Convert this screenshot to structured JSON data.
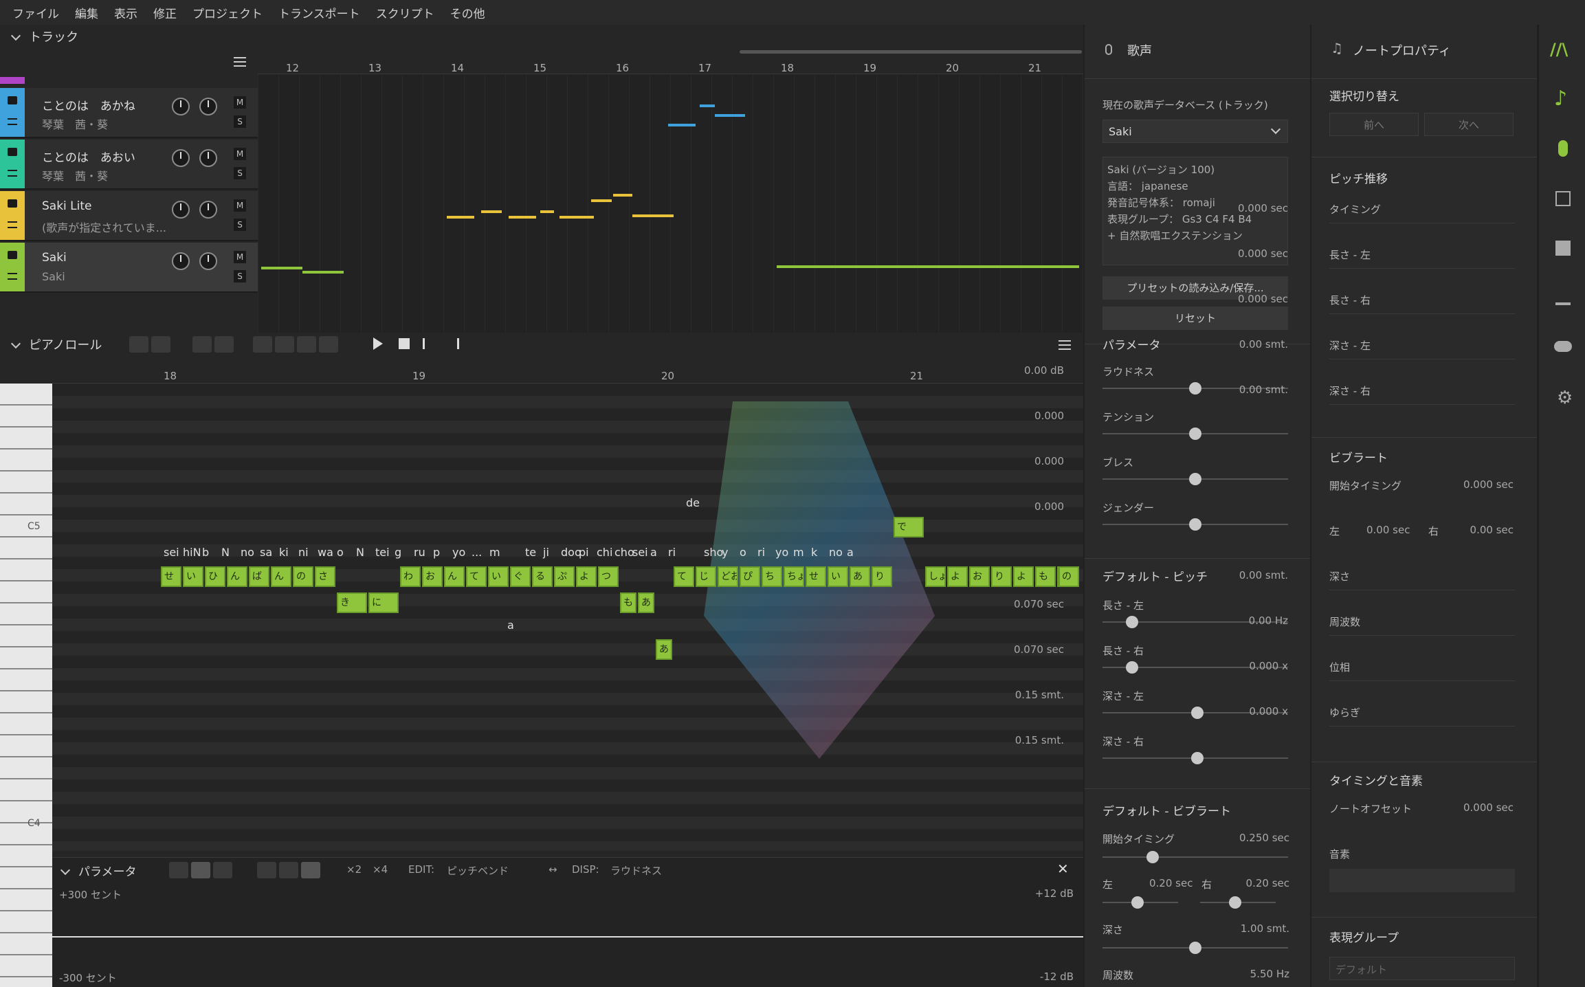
{
  "menu": [
    "ファイル",
    "編集",
    "表示",
    "修正",
    "プロジェクト",
    "トランスポート",
    "スクリプト",
    "その他"
  ],
  "track_panel": {
    "title": "トラック",
    "ruler": [
      "12",
      "13",
      "14",
      "15",
      "16",
      "17",
      "18",
      "19",
      "20",
      "21"
    ],
    "tracks": [
      {
        "name": "ことのは　あかね",
        "sub": "琴葉　茜・葵",
        "color": "#3fa2dc"
      },
      {
        "name": "ことのは　あおい",
        "sub": "琴葉　茜・葵",
        "color": "#2ec49a"
      },
      {
        "name": "Saki Lite",
        "sub": "(歌声が指定されていま...",
        "color": "#e8c23a"
      },
      {
        "name": "Saki",
        "sub": "Saki",
        "color": "#8fc53c"
      }
    ],
    "mute": "M",
    "solo": "S"
  },
  "piano_roll": {
    "title": "ピアノロール",
    "ruler": [
      "18",
      "19",
      "20",
      "21"
    ],
    "key_labels": [
      "C5",
      "C4"
    ],
    "phonemes": [
      "sei",
      "hiN",
      "b",
      "N",
      "no",
      "sa",
      "ki",
      "ni",
      "wa",
      "o",
      "N",
      "tei",
      "g",
      "ru",
      "p",
      "yo",
      "...",
      "m",
      "a",
      "te",
      "ji",
      "doo",
      "pi",
      "chi",
      "cho",
      "sei",
      "a",
      "ri",
      "de",
      "sho",
      "y",
      "o",
      "ri",
      "yo",
      "m",
      "k",
      "no",
      "a"
    ],
    "notes": [
      "せ",
      "い",
      "ひ",
      "ん",
      "ば",
      "ん",
      "の",
      "さ",
      "き",
      "に",
      "わ",
      "お",
      "ん",
      "て",
      "い",
      "ぐ",
      "る",
      "ぷ",
      "よ",
      "つ",
      "も",
      "あ",
      "あ",
      "て",
      "じ",
      "どお",
      "ぴ",
      "ち",
      "ちょ",
      "せ",
      "い",
      "あ",
      "り",
      "で",
      "しょ",
      "よ",
      "お",
      "り",
      "よ",
      "も",
      "か",
      "の"
    ]
  },
  "param_panel": {
    "title": "パラメータ",
    "x2": "×2",
    "x4": "×4",
    "edit_label": "EDIT:",
    "edit_value": "ピッチベンド",
    "disp_label": "DISP:",
    "disp_value": "ラウドネス",
    "top_left": "+300 セント",
    "bottom_left": "-300 セント",
    "top_right": "+12 dB",
    "bottom_right": "-12 dB"
  },
  "voice_panel": {
    "title": "歌声",
    "db_label": "現在の歌声データベース (トラック)",
    "db_value": "Saki",
    "info": [
      "Saki (バージョン 100)",
      "言語： japanese",
      "発音記号体系： romaji",
      "表現グループ： Gs3 C4 F4 B4",
      "+ 自然歌唱エクステンション"
    ],
    "preset_btn": "プリセットの読み込み/保存...",
    "reset_btn": "リセット",
    "params_title": "パラメータ",
    "params": [
      {
        "label": "ラウドネス",
        "value": "0.00 dB",
        "pos": 0.5
      },
      {
        "label": "テンション",
        "value": "0.000",
        "pos": 0.5
      },
      {
        "label": "ブレス",
        "value": "0.000",
        "pos": 0.5
      },
      {
        "label": "ジェンダー",
        "value": "0.000",
        "pos": 0.5
      }
    ],
    "pitch_title": "デフォルト - ピッチ",
    "pitch": [
      {
        "label": "長さ - 左",
        "value": "0.070 sec",
        "pos": 0.16
      },
      {
        "label": "長さ - 右",
        "value": "0.070 sec",
        "pos": 0.16
      },
      {
        "label": "深さ - 左",
        "value": "0.15 smt.",
        "pos": 0.51
      },
      {
        "label": "深さ - 右",
        "value": "0.15 smt.",
        "pos": 0.51
      }
    ],
    "vib_title": "デフォルト - ビブラート",
    "vib_start_label": "開始タイミング",
    "vib_start_value": "0.250 sec",
    "vib_left_label": "左",
    "vib_left_value": "0.20 sec",
    "vib_right_label": "右",
    "vib_right_value": "0.20 sec",
    "vib_depth_label": "深さ",
    "vib_depth_value": "1.00 smt.",
    "vib_freq_label": "周波数",
    "vib_freq_value": "5.50 Hz"
  },
  "note_panel": {
    "title": "ノートプロパティ",
    "sel_title": "選択切り替え",
    "prev": "前へ",
    "next": "次へ",
    "pitch_title": "ピッチ推移",
    "pitch": [
      {
        "label": "タイミング",
        "value": "0.000 sec"
      },
      {
        "label": "長さ - 左",
        "value": "0.000 sec"
      },
      {
        "label": "長さ - 右",
        "value": "0.000 sec"
      },
      {
        "label": "深さ - 左",
        "value": "0.00 smt."
      },
      {
        "label": "深さ - 右",
        "value": "0.00 smt."
      }
    ],
    "vib_title": "ビブラート",
    "vib_start_label": "開始タイミング",
    "vib_start_value": "0.000 sec",
    "vib_left_label": "左",
    "vib_left_value": "0.00 sec",
    "vib_right_label": "右",
    "vib_right_value": "0.00 sec",
    "vib_rest": [
      {
        "label": "深さ",
        "value": "0.00 smt."
      },
      {
        "label": "周波数",
        "value": "0.00 Hz"
      },
      {
        "label": "位相",
        "value": "0.000 x"
      },
      {
        "label": "ゆらぎ",
        "value": "0.000 x"
      }
    ],
    "timing_title": "タイミングと音素",
    "offset_label": "ノートオフセット",
    "offset_value": "0.000 sec",
    "phoneme_label": "音素",
    "expr_title": "表現グループ",
    "expr_value": "デフォルト"
  },
  "colors": {
    "accent": "#8fc53c",
    "bg": "#202020",
    "panel": "#2a2a2a"
  }
}
